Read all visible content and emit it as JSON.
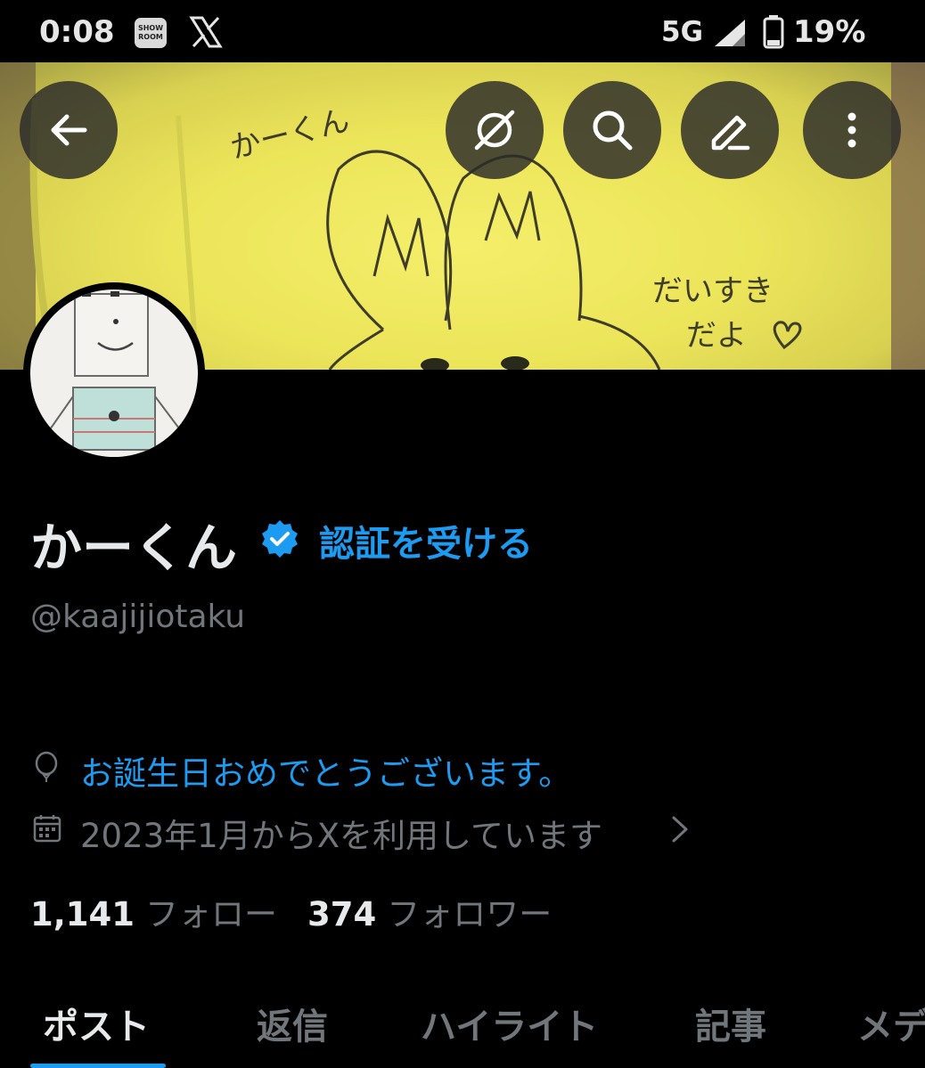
{
  "status_bar": {
    "time": "0:08",
    "app_icons": [
      "showroom-icon",
      "x-icon"
    ],
    "showroom_text": "SHOW ROOM",
    "network": "5G",
    "battery": "19%"
  },
  "header": {
    "buttons": [
      "back-arrow-icon",
      "grok-icon",
      "search-icon",
      "edit-icon",
      "more-vertical-icon"
    ]
  },
  "banner": {
    "handwriting_top": "かーくん",
    "handwriting_right_1": "だいすき",
    "handwriting_right_2": "だよ"
  },
  "profile": {
    "display_name": "かーくん",
    "verify_label": "認証を受ける",
    "handle": "@kaajijiotaku",
    "birthday": "お誕生日おめでとうございます。",
    "joined": "2023年1月からXを利用しています",
    "following_count": "1,141",
    "following_label": "フォロー",
    "followers_count": "374",
    "followers_label": "フォロワー"
  },
  "tabs": [
    {
      "label": "ポスト",
      "active": true
    },
    {
      "label": "返信",
      "active": false
    },
    {
      "label": "ハイライト",
      "active": false
    },
    {
      "label": "記事",
      "active": false
    },
    {
      "label": "メデ",
      "active": false
    }
  ],
  "colors": {
    "background": "#000000",
    "accent": "#1d9bf0",
    "text_primary": "#e7e9ea",
    "text_secondary": "#71767b",
    "banner_yellow": "#ece55a"
  }
}
